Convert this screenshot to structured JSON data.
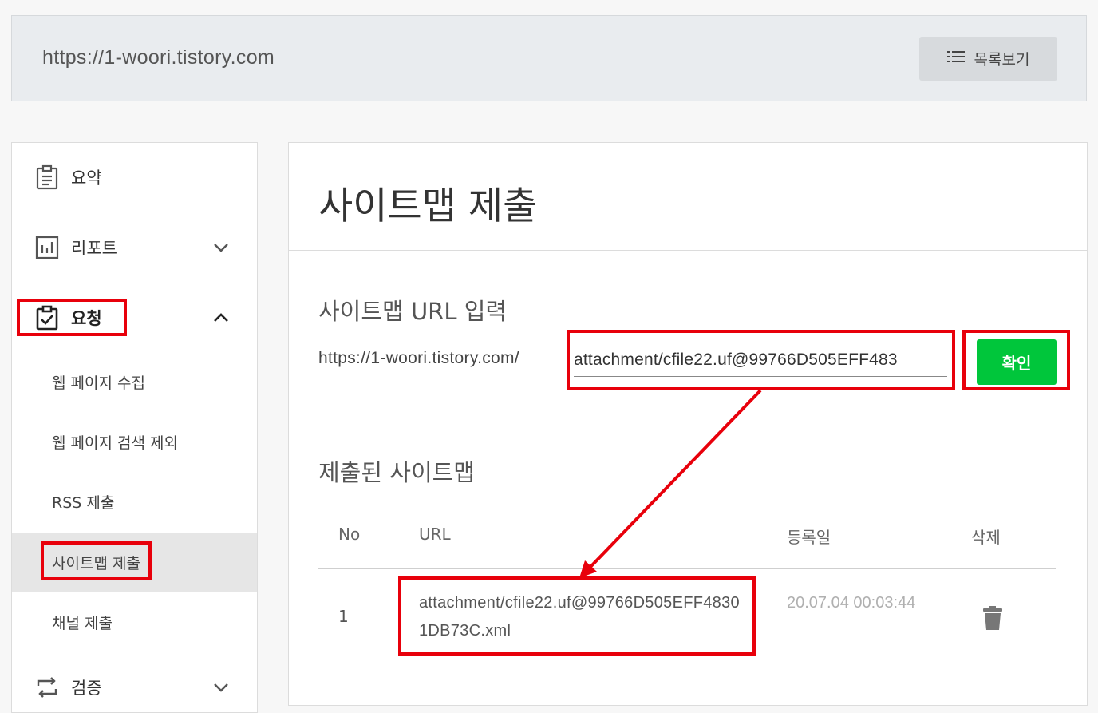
{
  "header": {
    "site_url": "https://1-woori.tistory.com",
    "list_button": "목록보기"
  },
  "sidebar": {
    "summary": "요약",
    "report": "리포트",
    "request": "요청",
    "sub": {
      "web_collect": "웹 페이지 수집",
      "web_exclude": "웹 페이지 검색 제외",
      "rss": "RSS 제출",
      "sitemap": "사이트맵 제출",
      "channel": "채널 제출"
    },
    "verify": "검증"
  },
  "main": {
    "title": "사이트맵 제출",
    "input_section_title": "사이트맵 URL 입력",
    "url_prefix": "https://1-woori.tistory.com/",
    "url_value": "attachment/cfile22.uf@99766D505EFF483",
    "confirm_button": "확인",
    "submitted_section_title": "제출된 사이트맵",
    "table": {
      "headers": {
        "no": "No",
        "url": "URL",
        "date": "등록일",
        "delete": "삭제"
      },
      "rows": [
        {
          "no": "1",
          "url": "attachment/cfile22.uf@99766D505EFF48301DB73C.xml",
          "date": "20.07.04 00:03:44"
        }
      ]
    }
  },
  "colors": {
    "highlight": "#e8000b",
    "confirm_green": "#00c63b"
  },
  "icons": [
    "list-icon",
    "clipboard-icon",
    "bar-chart-icon",
    "clipboard-check-icon",
    "repeat-icon",
    "chevron-down-icon",
    "chevron-up-icon",
    "trash-icon"
  ]
}
